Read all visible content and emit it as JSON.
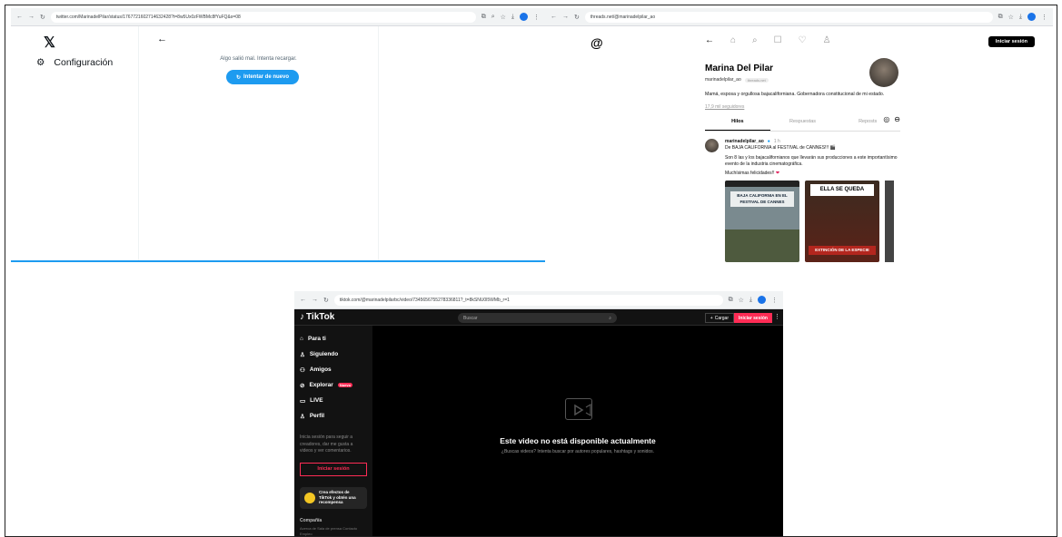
{
  "x_window": {
    "url": "twitter.com/MarinadelPilar/status/1767721602714632428?t=8w5Ux0zFWBMc8fYuFQ&s=08",
    "logo": "𝕏",
    "settings_label": "Configuración",
    "error_text": "Algo salió mal. Intenta recargar.",
    "retry_label": "Intentar de nuevo"
  },
  "threads_window": {
    "url": "threads.net/@marinadelpilar_ao",
    "login_label": "Iniciar sesión",
    "profile": {
      "name": "Marina Del Pilar",
      "handle": "marinadelpilar_ao",
      "domain_pill": "threads.net",
      "bio": "Mamá, esposa y orgullosa bajacaliforniana. Gobernadora constitucional de mi estado.",
      "followers": "17,9 mil seguidores"
    },
    "tabs": [
      "Hilos",
      "Respuestas",
      "Reposts"
    ],
    "post": {
      "author": "marinadelpilar_ao",
      "time": "1 h",
      "line1": "De BAJA CALIFORNIA al FESTIVAL de CANNES!!! 🎬",
      "line2": "Son 8 las y los bajacalifornianos que llevarán sus producciones a este importantísimo evento de la industria cinematográfica.",
      "line3": "Muchísimas felicidades!!",
      "image1_caption": "BAJA CALIFORNIA EN EL FESTIVAL DE CANNES",
      "image2_caption": "ELLA SE QUEDA",
      "image2_caption2": "EXTINCIÓN DE LA ESPECIE"
    }
  },
  "tiktok_window": {
    "url": "tiktok.com/@marinadelpilarbc/video/7345656755278336811?_t=8kSNU0l5WMb_r=1",
    "logo": "TikTok",
    "search_placeholder": "Buscar",
    "upload_label": "Cargar",
    "login_label": "Iniciar sesión",
    "nav": [
      {
        "icon": "home-icon",
        "glyph": "⌂",
        "label": "Para ti"
      },
      {
        "icon": "following-icon",
        "glyph": "♙",
        "label": "Siguiendo"
      },
      {
        "icon": "friends-icon",
        "glyph": "⚇",
        "label": "Amigos"
      },
      {
        "icon": "explore-icon",
        "glyph": "⊘",
        "label": "Explorar",
        "badge": "Nuevo"
      },
      {
        "icon": "live-icon",
        "glyph": "▭",
        "label": "LIVE"
      },
      {
        "icon": "profile-icon",
        "glyph": "♙",
        "label": "Perfil"
      }
    ],
    "login_hint": "Inicia sesión para seguir a creadores, dar me gusta a videos y ver comentarios.",
    "login_button": "Iniciar sesión",
    "promo": "Crea efectos de TikTok y obtén una recompensa",
    "footer_heading": "Compañía",
    "footer_links": "Acerca de  Sala de prensa  Contacto  Empleo",
    "unavailable_title": "Este video no está disponible actualmente",
    "unavailable_sub": "¿Buscas videos? Intenta buscar por autores populares, hashtags y sonidos."
  }
}
